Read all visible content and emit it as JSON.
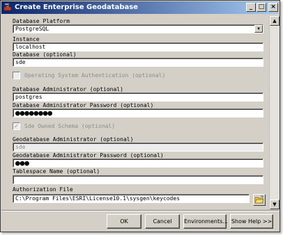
{
  "window": {
    "title": "Create Enterprise Geodatabase",
    "title_icon": "hammer-toolbox-icon",
    "controls": [
      "minimize-icon",
      "maximize-icon",
      "close-icon"
    ]
  },
  "form": {
    "database_platform": {
      "label": "Database Platform",
      "value": "PostgreSQL"
    },
    "instance": {
      "label": "Instance",
      "value": "localhost"
    },
    "database": {
      "label": "Database (optional)",
      "value": "sde"
    },
    "os_auth": {
      "label": "Operating System Authentication (optional)",
      "checked": false,
      "enabled": false
    },
    "db_admin": {
      "label": "Database Administrator (optional)",
      "value": "postgres"
    },
    "db_admin_password": {
      "label": "Database Administrator Password (optional)",
      "value": "●●●●●●●●"
    },
    "sde_owned_schema": {
      "label": "Sde Owned Schema (optional)",
      "checked": true,
      "enabled": false
    },
    "gdb_admin": {
      "label": "Geodatabase Administrator (optional)",
      "value": "sde",
      "enabled": false
    },
    "gdb_admin_password": {
      "label": "Geodatabase Administrator Password (optional)",
      "value": "●●●"
    },
    "tablespace": {
      "label": "Tablespace Name (optional)",
      "value": ""
    },
    "authorization_file": {
      "label": "Authorization File",
      "value": "C:\\Program Files\\ESRI\\License10.1\\sysgen\\keycodes",
      "browse_icon": "open-folder-icon"
    }
  },
  "buttons": {
    "ok": "OK",
    "cancel": "Cancel",
    "environments": "Environments...",
    "show_help": "Show Help >>"
  },
  "colors": {
    "titlebar_start": "#0a246a",
    "titlebar_end": "#a6caf0",
    "dialog_face": "#d4d0c8"
  }
}
